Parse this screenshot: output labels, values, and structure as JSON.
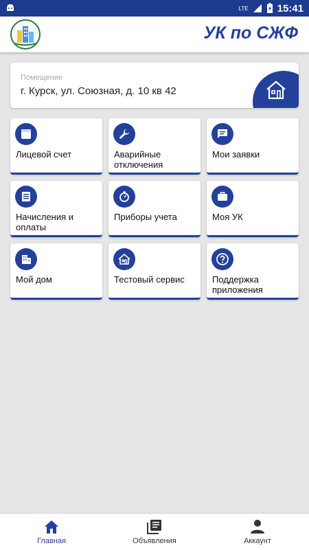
{
  "status_bar": {
    "network": "LTE",
    "time": "15:41"
  },
  "app_bar": {
    "title": "УК по СЖФ",
    "logo_icon": "building-logo-icon"
  },
  "premises": {
    "label": "Помещение",
    "address": "г. Курск, ул. Союзная, д. 10 кв 42",
    "icon": "house-icon"
  },
  "tiles": [
    {
      "label": "Лицевой счет",
      "icon": "account-card-icon"
    },
    {
      "label": "Аварийные отключения",
      "icon": "wrench-icon"
    },
    {
      "label": "Мои заявки",
      "icon": "message-icon"
    },
    {
      "label": "Начисления и оплаты",
      "icon": "receipt-icon"
    },
    {
      "label": "Приборы учета",
      "icon": "meter-icon"
    },
    {
      "label": "Моя УК",
      "icon": "briefcase-icon"
    },
    {
      "label": "Мой дом",
      "icon": "building-icon"
    },
    {
      "label": "Тестовый сервис",
      "icon": "house-icon"
    },
    {
      "label": "Поддержка приложения",
      "icon": "help-icon"
    }
  ],
  "bottom_nav": [
    {
      "label": "Главная",
      "icon": "home-icon",
      "active": true
    },
    {
      "label": "Объявления",
      "icon": "news-icon",
      "active": false
    },
    {
      "label": "Аккаунт",
      "icon": "person-icon",
      "active": false
    }
  ],
  "colors": {
    "primary": "#23409a",
    "status_bar": "#1c3a8e",
    "background": "#e6e6e6"
  }
}
